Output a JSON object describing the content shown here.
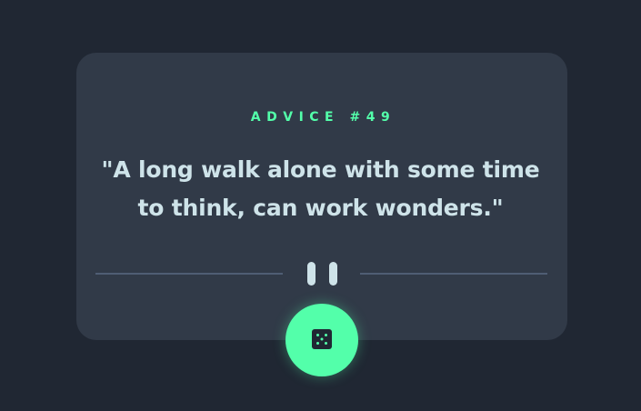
{
  "advice": {
    "label": "ADVICE #49",
    "quote": "\"A long walk alone with some time to think, can work wonders.\""
  },
  "icons": {
    "divider": "pause-icon",
    "button": "dice-icon"
  },
  "colors": {
    "background": "#202733",
    "card": "#313a48",
    "accent": "#53ffaa",
    "text": "#cee3e9",
    "divider": "#4f5d74"
  }
}
